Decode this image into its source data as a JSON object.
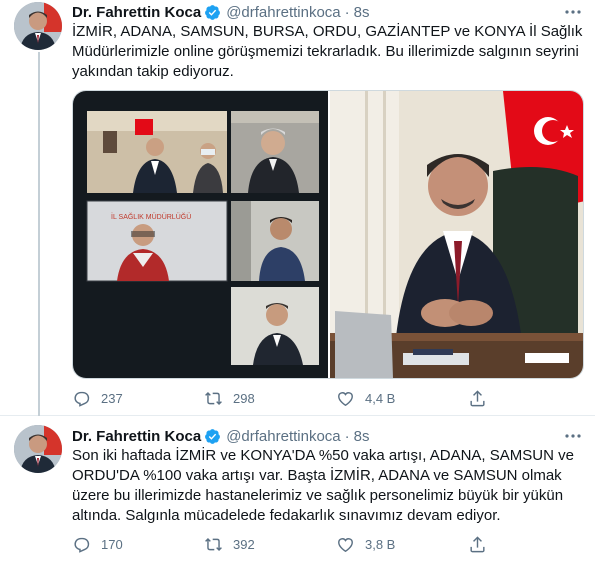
{
  "tweets": [
    {
      "author_name": "Dr. Fahrettin Koca",
      "handle": "@drfahrettinkoca",
      "separator": "·",
      "time": "8s",
      "text": "İZMİR, ADANA, SAMSUN, BURSA, ORDU, GAZİANTEP ve KONYA İl Sağlık Müdürlerimizle online görüşmemizi tekrarladık. Bu illerimizde salgının seyrini yakından takip ediyoruz.",
      "video_call_caption": "İL SAĞLIK MÜDÜRLÜĞÜ",
      "replies": "237",
      "retweets": "298",
      "likes": "4,4 B"
    },
    {
      "author_name": "Dr. Fahrettin Koca",
      "handle": "@drfahrettinkoca",
      "separator": "·",
      "time": "8s",
      "text": "Son iki haftada İZMİR ve KONYA'DA %50 vaka artışı, ADANA, SAMSUN ve ORDU'DA %100 vaka artışı var. Başta İZMİR, ADANA ve SAMSUN olmak üzere bu illerimizde hastanelerimiz ve sağlık personelimiz büyük bir yükün altında. Salgınla mücadelede fedakarlık sınavımız devam ediyor.",
      "replies": "170",
      "retweets": "392",
      "likes": "3,8 B"
    }
  ],
  "icons": [
    "avatar",
    "verified-badge-icon",
    "more-icon",
    "reply-icon",
    "retweet-icon",
    "like-icon",
    "share-icon"
  ],
  "colors": {
    "verified": "#1da1f2",
    "secondary_text": "#5b7083",
    "flag_red": "#e30a17"
  }
}
